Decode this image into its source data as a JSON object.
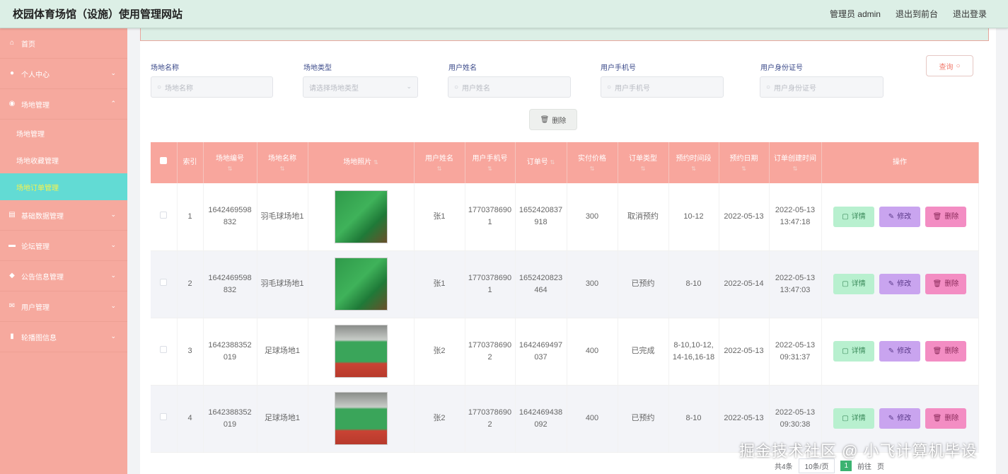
{
  "app": {
    "title": "校园体育场馆（设施）使用管理网站",
    "admin_label": "管理员 admin",
    "back_front": "退出到前台",
    "logout": "退出登录"
  },
  "sidebar": {
    "items": [
      {
        "label": "首页",
        "icon": "home-icon"
      },
      {
        "label": "个人中心",
        "icon": "user-icon"
      },
      {
        "label": "场地管理",
        "icon": "location-icon"
      },
      {
        "label": "基础数据管理",
        "icon": "data-icon"
      },
      {
        "label": "论坛管理",
        "icon": "forum-icon"
      },
      {
        "label": "公告信息管理",
        "icon": "notice-icon"
      },
      {
        "label": "用户管理",
        "icon": "mail-icon"
      },
      {
        "label": "轮播图信息",
        "icon": "chart-icon"
      }
    ],
    "sub_items": [
      {
        "label": "场地管理"
      },
      {
        "label": "场地收藏管理"
      },
      {
        "label": "场地订单管理"
      }
    ]
  },
  "search": {
    "venue_name_label": "场地名称",
    "venue_name_placeholder": "场地名称",
    "venue_type_label": "场地类型",
    "venue_type_placeholder": "请选择场地类型",
    "user_name_label": "用户姓名",
    "user_name_placeholder": "用户姓名",
    "user_phone_label": "用户手机号",
    "user_phone_placeholder": "用户手机号",
    "user_id_label": "用户身份证号",
    "user_id_placeholder": "用户身份证号",
    "query_button": "查询",
    "delete_button": "删除"
  },
  "table": {
    "headers": [
      "索引",
      "场地编号",
      "场地名称",
      "场地照片",
      "用户姓名",
      "用户手机号",
      "订单号",
      "实付价格",
      "订单类型",
      "预约时间段",
      "预约日期",
      "订单创建时间",
      "操作"
    ],
    "rows": [
      {
        "index": "1",
        "venue_no": "1642469598832",
        "venue_name": "羽毛球场地1",
        "photo": "badminton",
        "user": "张1",
        "phone": "17703786901",
        "order_no": "1652420837918",
        "price": "300",
        "type": "取消预约",
        "slot": "10-12",
        "date": "2022-05-13",
        "created": "2022-05-13 13:47:18"
      },
      {
        "index": "2",
        "venue_no": "1642469598832",
        "venue_name": "羽毛球场地1",
        "photo": "badminton",
        "user": "张1",
        "phone": "17703786901",
        "order_no": "1652420823464",
        "price": "300",
        "type": "已预约",
        "slot": "8-10",
        "date": "2022-05-14",
        "created": "2022-05-13 13:47:03"
      },
      {
        "index": "3",
        "venue_no": "1642388352019",
        "venue_name": "足球场地1",
        "photo": "soccer",
        "user": "张2",
        "phone": "17703786902",
        "order_no": "1642469497037",
        "price": "400",
        "type": "已完成",
        "slot": "8-10,10-12,14-16,16-18",
        "date": "2022-05-13",
        "created": "2022-05-13 09:31:37"
      },
      {
        "index": "4",
        "venue_no": "1642388352019",
        "venue_name": "足球场地1",
        "photo": "soccer",
        "user": "张2",
        "phone": "17703786902",
        "order_no": "1642469438092",
        "price": "400",
        "type": "已预约",
        "slot": "8-10",
        "date": "2022-05-13",
        "created": "2022-05-13 09:30:38"
      }
    ],
    "actions": {
      "detail": "详情",
      "edit": "修改",
      "delete": "删除"
    }
  },
  "pager": {
    "total": "共4条",
    "page_size": "10条/页",
    "current_page": "1",
    "goto": "前往",
    "page_suffix": "页"
  },
  "watermark": "掘金技术社区 @ 小飞计算机毕设"
}
